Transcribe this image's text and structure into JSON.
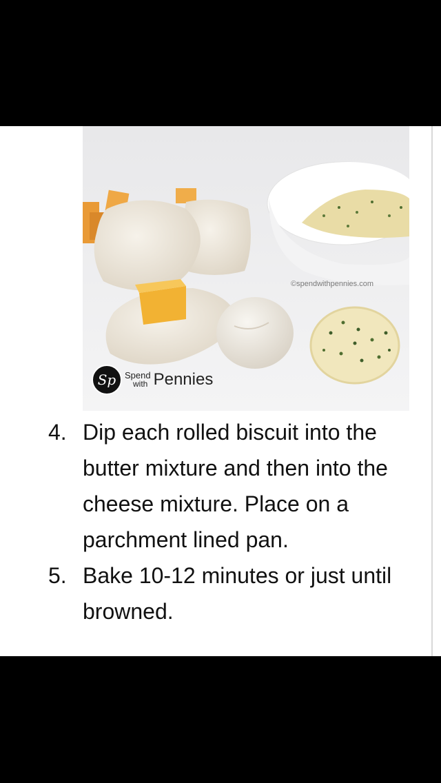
{
  "photo": {
    "watermark": "©spendwithpennies.com",
    "logo_badge": "Sp",
    "logo_spend": "Spend",
    "logo_with": "with",
    "logo_pennies": "Pennies"
  },
  "steps": [
    {
      "number": "4.",
      "text": "Dip each rolled biscuit into the butter mixture and then into the cheese mixture. Place on a parchment lined pan."
    },
    {
      "number": "5.",
      "text": "Bake 10-12 minutes or just until browned."
    }
  ]
}
